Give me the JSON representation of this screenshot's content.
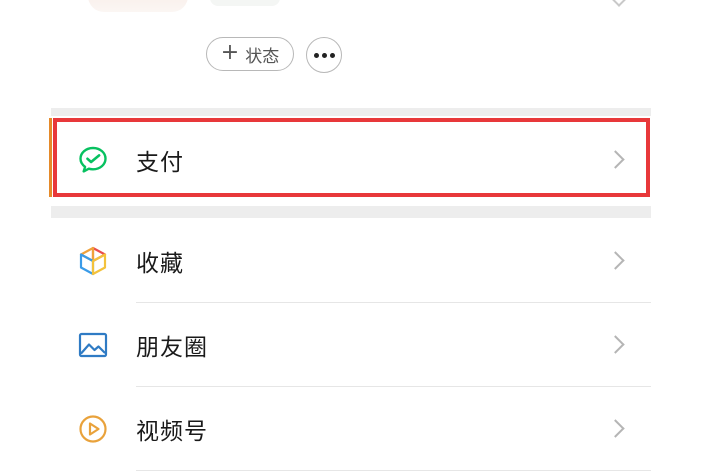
{
  "profile": {
    "status_button_label": "状态",
    "status_button_icon": "plus-icon",
    "more_button_icon": "more-horizontal-icon"
  },
  "menu": {
    "items": [
      {
        "label": "支付",
        "icon": "wechat-pay-icon",
        "highlighted": true
      },
      {
        "label": "收藏",
        "icon": "favorites-cube-icon",
        "highlighted": false
      },
      {
        "label": "朋友圈",
        "icon": "moments-image-icon",
        "highlighted": false
      },
      {
        "label": "视频号",
        "icon": "channels-play-icon",
        "highlighted": false
      }
    ]
  },
  "colors": {
    "highlight_border": "#e8383a",
    "pay_green": "#07c160",
    "background_band": "#ededed",
    "text_primary": "#1a1a1a",
    "chevron": "#b5b5b5"
  }
}
